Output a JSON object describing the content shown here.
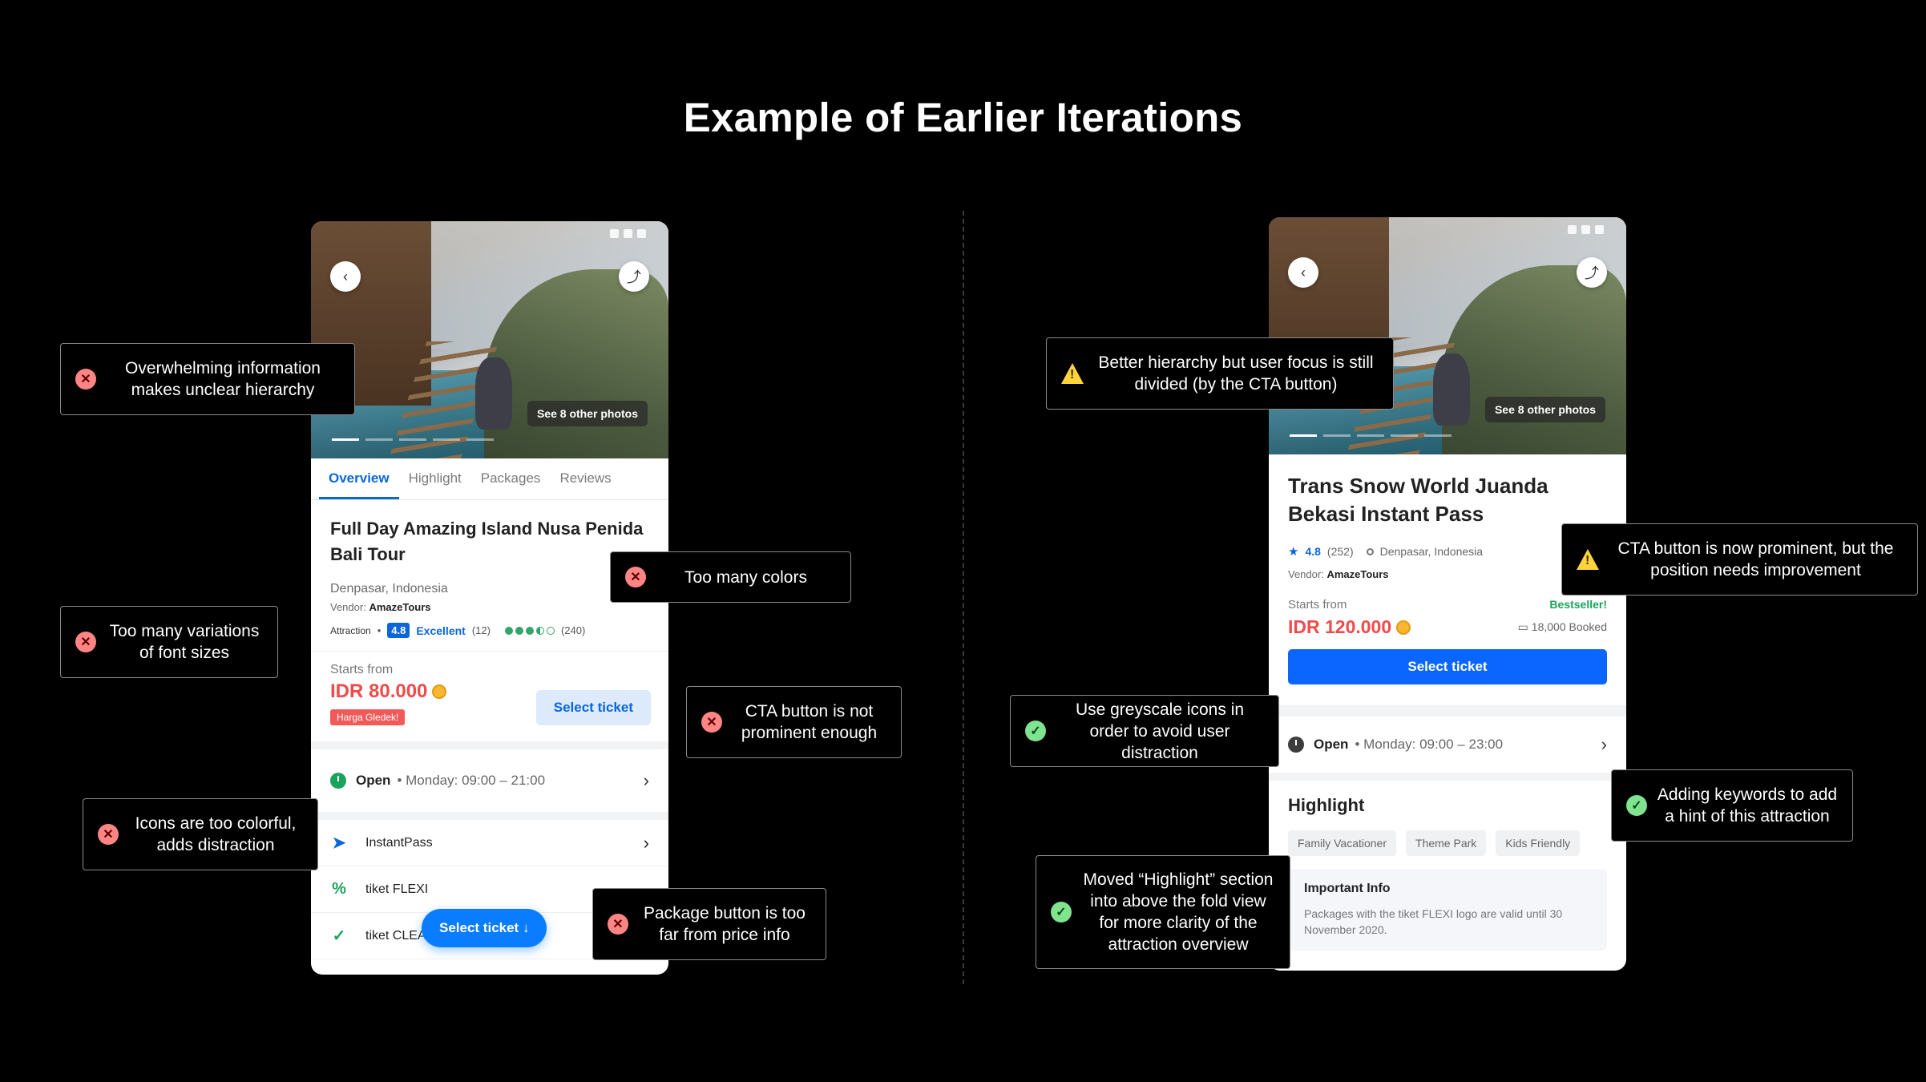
{
  "page_title": "Example of Earlier Iterations",
  "left_phone": {
    "photos_label": "See 8 other photos",
    "tabs": [
      "Overview",
      "Highlight",
      "Packages",
      "Reviews"
    ],
    "title": "Full Day Amazing Island Nusa Penida Bali Tour",
    "location": "Denpasar, Indonesia",
    "vendor_label": "Vendor:",
    "vendor_name": "AmazeTours",
    "category": "Attraction",
    "score": "4.8",
    "score_label": "Excellent",
    "score_count": "(12)",
    "ta_count": "(240)",
    "starts_from": "Starts from",
    "price": "IDR 80.000",
    "flash_badge": "Harga Gledek!",
    "select_ticket": "Select ticket",
    "open": "Open",
    "hours": "Monday: 09:00 – 21:00",
    "features": [
      "InstantPass",
      "tiket FLEXI",
      "tiket CLEAN"
    ],
    "floating_cta": "Select ticket"
  },
  "right_phone": {
    "photos_label": "See 8 other photos",
    "title": "Trans Snow World Juanda Bekasi Instant Pass",
    "rating": "4.8",
    "rating_count": "(252)",
    "location": "Denpasar, Indonesia",
    "vendor_label": "Vendor:",
    "vendor_name": "AmazeTours",
    "starts_from": "Starts from",
    "bestseller": "Bestseller!",
    "price": "IDR 120.000",
    "booked": "18,000 Booked",
    "select_ticket": "Select ticket",
    "open": "Open",
    "hours": "Monday: 09:00 – 23:00",
    "highlight_title": "Highlight",
    "chips": [
      "Family Vacationer",
      "Theme Park",
      "Kids Friendly"
    ],
    "info_title": "Important Info",
    "info_text": "Packages with the tiket FLEXI logo are valid until 30 November 2020."
  },
  "notes": {
    "overwhelming": "Overwhelming information makes unclear hierarchy",
    "font_sizes": "Too many variations of font sizes",
    "colorful_icons": "Icons are too colorful, adds distraction",
    "too_many_colors": "Too many colors",
    "cta_not_prominent": "CTA button is not prominent enough",
    "package_button": "Package button is too far from price info",
    "better_hierarchy": "Better hierarchy but user focus is still divided (by the CTA button)",
    "greyscale_icons": "Use greyscale icons in order to avoid user distraction",
    "moved_highlight": "Moved “Highlight” section into above the fold view for more clarity of the attraction overview",
    "cta_prominent": "CTA button is now prominent, but the position needs improvement",
    "keywords": "Adding keywords to add a hint of this attraction"
  },
  "colors": {
    "accent_blue": "#0a66ff",
    "price_red": "#ee4b4b",
    "good": "#7fe38f",
    "bad": "#ff8585",
    "warn": "#ffd43b"
  }
}
